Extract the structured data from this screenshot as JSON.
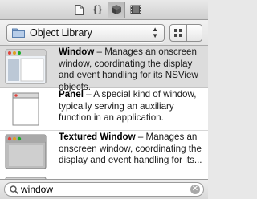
{
  "tabs": [
    {
      "name": "file-template-library",
      "icon": "document-icon"
    },
    {
      "name": "code-snippet-library",
      "icon": "braces-icon",
      "glyph": "{}"
    },
    {
      "name": "object-library",
      "icon": "cube-icon",
      "active": true
    },
    {
      "name": "media-library",
      "icon": "film-icon"
    }
  ],
  "library_selector": {
    "label": "Object Library",
    "icon": "folder-icon",
    "stepper_icon": "up-down-arrows-icon",
    "stepper_glyph": "▲▼"
  },
  "view_toggle": {
    "grid_icon": "grid-view-icon",
    "list_icon": "list-view-icon",
    "selected": "list"
  },
  "items": [
    {
      "title": "Window",
      "description": " – Manages an onscreen window, coordinating the display and event handling for its NSView objects.",
      "icon": "window-thumbnail-icon",
      "selected": true
    },
    {
      "title": "Panel",
      "description": " – A special kind of window, typically serving an auxiliary function in an application.",
      "icon": "panel-thumbnail-icon",
      "selected": false
    },
    {
      "title": "Textured Window",
      "description": " – Manages an onscreen window, coordinating the display and event handling for its...",
      "icon": "textured-window-thumbnail-icon",
      "selected": false
    }
  ],
  "search": {
    "value": "window",
    "clear_glyph": "✕"
  },
  "colors": {
    "selected_row": "#dcdcdc",
    "traffic_red": "#e0443e",
    "traffic_yellow": "#dea123",
    "traffic_green": "#1aab29"
  }
}
